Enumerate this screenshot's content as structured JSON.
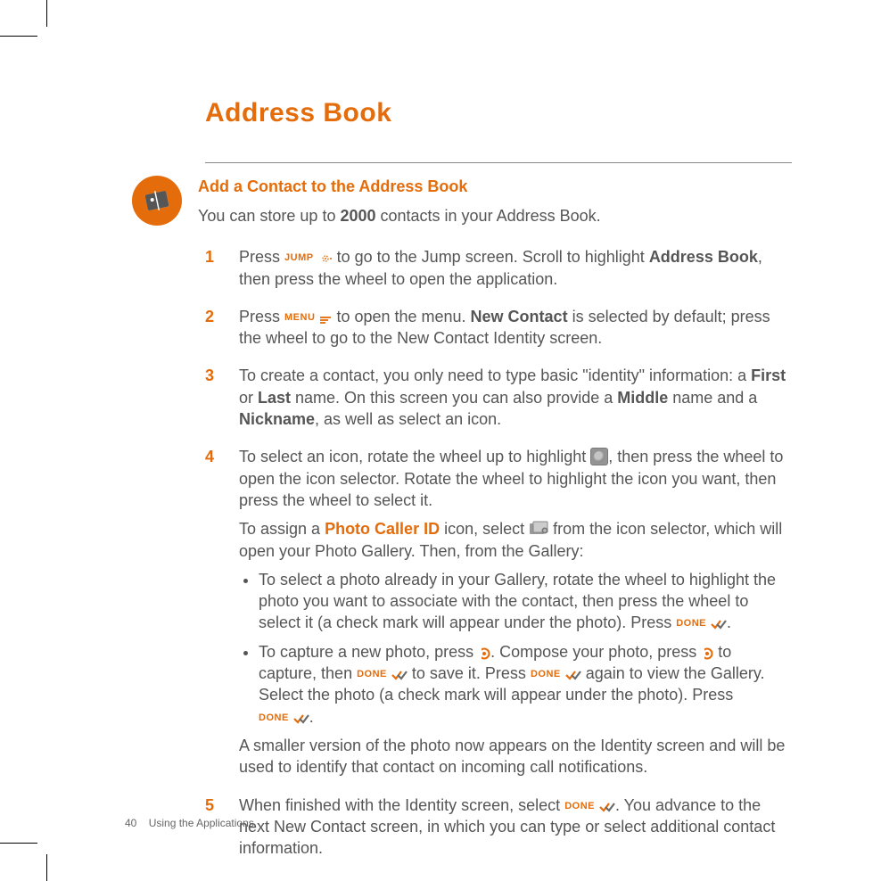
{
  "title": "Address Book",
  "section_title": "Add a Contact to the Address Book",
  "intro_pre": "You can store up to ",
  "intro_bold": "2000",
  "intro_post": " contacts in your Address Book.",
  "labels": {
    "jump": "JUMP",
    "menu": "MENU",
    "done": "DONE"
  },
  "steps": [
    {
      "num": "1",
      "a": "Press ",
      "b": " to go to the Jump screen. Scroll to highlight ",
      "c": "Address Book",
      "d": ", then press the wheel to open the application."
    },
    {
      "num": "2",
      "a": "Press ",
      "b": " to open the menu. ",
      "c": "New Contact",
      "d": " is selected by default; press the wheel to go to the New Contact Identity screen."
    },
    {
      "num": "3",
      "a": "To create a contact, you only need to type basic \"identity\" information: a ",
      "b": "First",
      "c": " or ",
      "d": "Last",
      "e": " name. On this screen you can also provide a ",
      "f": "Middle",
      "g": " name and a ",
      "h": "Nickname",
      "i": ", as well as select an icon."
    },
    {
      "num": "4",
      "p1a": "To select an icon, rotate the wheel up to highlight ",
      "p1b": ", then press the wheel to open the icon selector. Rotate the wheel to highlight the icon you want, then press the wheel to select it.",
      "p2a": "To assign a ",
      "p2b": "Photo Caller ID",
      "p2c": " icon, select  ",
      "p2d": " from the icon selector, which will open your Photo Gallery. Then, from the Gallery:",
      "b1a": "To select a photo already in your Gallery, rotate the wheel to highlight the photo you want to associate with the contact, then press the wheel to select it (a check mark will appear under the photo). Press ",
      "b1b": ".",
      "b2a": "To capture a new photo, press ",
      "b2b": ". Compose your photo, press ",
      "b2c": " to capture, then ",
      "b2d": " to save it. Press ",
      "b2e": " again to view the Gallery. Select the photo (a check mark will appear under the photo). Press ",
      "b2f": ".",
      "p3": "A smaller version of the photo now appears on the Identity screen and will be used to identify that contact on incoming call notifications."
    },
    {
      "num": "5",
      "a": "When finished with the Identity screen, select ",
      "b": ". You advance to the next New Contact screen, in which you can type or select additional contact information."
    }
  ],
  "footer": {
    "page": "40",
    "label": "Using the Applications"
  }
}
